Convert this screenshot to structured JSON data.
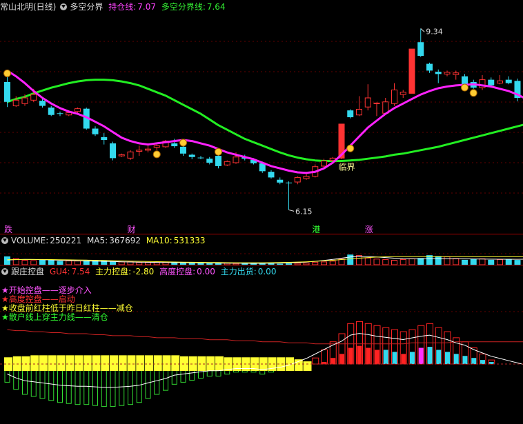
{
  "header": {
    "stock_title": "常山北明(日线)",
    "indicator_name": "多空分界",
    "hold_label": "持仓线:",
    "hold_value": "7.07",
    "boundary_label": "多空分界线:",
    "boundary_value": "7.64"
  },
  "annotations": {
    "high": "9.34",
    "low": "6.15",
    "cross": "临界"
  },
  "markers": [
    {
      "text": "跌",
      "color": "#ff55ff",
      "candle": 0
    },
    {
      "text": "财",
      "color": "#ff55ff",
      "candle": 14
    },
    {
      "text": "港",
      "color": "#33ff33",
      "candle": 35
    },
    {
      "text": "涨",
      "color": "#ff55ff",
      "candle": 41
    }
  ],
  "volume_header": {
    "label": "VOLUME:",
    "value": "250221",
    "ma5_label": "MA5:",
    "ma5_value": "367692",
    "ma10_label": "MA10:",
    "ma10_value": "531333"
  },
  "control_header": {
    "name": "跟庄控盘",
    "gu4_label": "GU4:",
    "gu4_value": "7.54",
    "main_label": "主力控盘:",
    "main_value": "-2.80",
    "high_label": "高度控盘:",
    "high_value": "0.00",
    "ship_label": "主力出货:",
    "ship_value": "0.00"
  },
  "legend": [
    {
      "text": "开始控盘——逐步介入",
      "color": "#ff55ff"
    },
    {
      "text": "高度控盘——启动",
      "color": "#ff3333"
    },
    {
      "text": "收盘前红柱低于昨日红柱——减仓",
      "color": "#ffff33"
    },
    {
      "text": "散户线上穿主力线——清仓",
      "color": "#33ff33"
    }
  ],
  "colors": {
    "up": "#ff3333",
    "down": "#33d9ee",
    "hold_line": "#ff22ff",
    "boundary_line": "#22ee22",
    "yellow": "#ffff33",
    "magenta": "#ff55ff",
    "green": "#33ff33"
  },
  "chart_data": {
    "type": "candlestick",
    "price_range": [
      5.9,
      9.6
    ],
    "high_label": 9.34,
    "low_label": 6.15,
    "candles": [
      [
        8.4,
        8.05,
        8.5,
        7.96
      ],
      [
        7.98,
        8.08,
        8.15,
        7.96
      ],
      [
        8.02,
        8.12,
        8.18,
        7.98
      ],
      [
        8.08,
        8.18,
        8.28,
        8.05
      ],
      [
        8.07,
        7.98,
        8.12,
        7.95
      ],
      [
        7.95,
        7.82,
        7.98,
        7.8
      ],
      [
        7.85,
        7.84,
        7.88,
        7.8
      ],
      [
        7.82,
        7.86,
        7.9,
        7.8
      ],
      [
        7.88,
        7.93,
        7.95,
        7.86
      ],
      [
        7.93,
        7.58,
        7.95,
        7.56
      ],
      [
        7.58,
        7.48,
        7.62,
        7.45
      ],
      [
        7.43,
        7.38,
        7.5,
        7.3
      ],
      [
        7.32,
        7.06,
        7.35,
        7.02
      ],
      [
        7.1,
        7.12,
        7.14,
        7.08
      ],
      [
        7.06,
        7.17,
        7.2,
        7.03
      ],
      [
        7.18,
        7.2,
        7.28,
        7.1
      ],
      [
        7.2,
        7.22,
        7.32,
        7.16
      ],
      [
        7.25,
        7.28,
        7.3,
        7.2
      ],
      [
        7.26,
        7.36,
        7.38,
        7.24
      ],
      [
        7.32,
        7.27,
        7.4,
        7.24
      ],
      [
        7.26,
        7.14,
        7.3,
        7.1
      ],
      [
        7.12,
        7.08,
        7.14,
        7.04
      ],
      [
        7.07,
        7.06,
        7.1,
        7.04
      ],
      [
        7.05,
        6.98,
        7.08,
        6.95
      ],
      [
        7.1,
        6.92,
        7.12,
        6.88
      ],
      [
        6.94,
        7.0,
        7.02,
        6.92
      ],
      [
        6.98,
        7.08,
        7.16,
        6.96
      ],
      [
        7.08,
        7.05,
        7.12,
        7.02
      ],
      [
        7.03,
        6.97,
        7.06,
        6.95
      ],
      [
        6.97,
        6.83,
        7.0,
        6.8
      ],
      [
        6.82,
        6.72,
        6.85,
        6.7
      ],
      [
        6.68,
        6.63,
        6.72,
        6.6
      ],
      [
        6.63,
        6.62,
        6.65,
        6.15
      ],
      [
        6.64,
        6.72,
        6.74,
        6.6
      ],
      [
        6.7,
        6.74,
        6.78,
        6.68
      ],
      [
        6.74,
        6.91,
        6.95,
        6.72
      ],
      [
        6.92,
        7.01,
        7.05,
        6.9
      ],
      [
        7.02,
        7.06,
        7.08,
        7.0
      ],
      [
        7.06,
        7.66,
        7.66,
        7.04
      ],
      [
        7.9,
        7.78,
        7.92,
        7.76
      ],
      [
        7.82,
        7.92,
        8.15,
        7.8
      ],
      [
        7.96,
        8.12,
        8.36,
        7.9
      ],
      [
        8.02,
        8.03,
        8.04,
        7.8
      ],
      [
        7.85,
        8.05,
        8.12,
        7.83
      ],
      [
        8.02,
        8.26,
        8.38,
        7.98
      ],
      [
        8.18,
        8.22,
        8.26,
        8.12
      ],
      [
        8.2,
        8.98,
        8.98,
        8.2
      ],
      [
        9.1,
        8.86,
        9.34,
        8.84
      ],
      [
        8.72,
        8.6,
        8.74,
        8.56
      ],
      [
        8.58,
        8.54,
        8.62,
        8.38
      ],
      [
        8.54,
        8.57,
        8.6,
        8.5
      ],
      [
        8.53,
        8.56,
        8.6,
        8.44
      ],
      [
        8.5,
        8.36,
        8.54,
        8.34
      ],
      [
        8.4,
        8.3,
        8.44,
        8.28
      ],
      [
        8.3,
        8.44,
        8.52,
        8.26
      ],
      [
        8.44,
        8.34,
        8.48,
        8.3
      ],
      [
        8.38,
        8.42,
        8.52,
        8.36
      ],
      [
        8.44,
        8.38,
        8.5,
        8.36
      ],
      [
        8.42,
        8.12,
        8.46,
        8.06
      ],
      [
        8.05,
        7.82,
        8.08,
        7.8
      ],
      [
        7.9,
        7.65,
        7.98,
        7.62
      ]
    ],
    "hold_line": [
      8.6,
      8.5,
      8.38,
      8.24,
      8.12,
      8.02,
      7.94,
      7.88,
      7.84,
      7.78,
      7.7,
      7.62,
      7.52,
      7.42,
      7.36,
      7.32,
      7.3,
      7.32,
      7.34,
      7.36,
      7.38,
      7.36,
      7.32,
      7.28,
      7.22,
      7.16,
      7.12,
      7.08,
      7.04,
      6.98,
      6.92,
      6.88,
      6.84,
      6.81,
      6.8,
      6.82,
      6.88,
      6.98,
      7.12,
      7.28,
      7.44,
      7.6,
      7.72,
      7.84,
      7.94,
      8.02,
      8.1,
      8.18,
      8.24,
      8.29,
      8.32,
      8.34,
      8.35,
      8.36,
      8.34,
      8.32,
      8.28,
      8.24,
      8.18,
      8.1,
      8.0
    ],
    "boundary_line": [
      8.05,
      8.1,
      8.14,
      8.2,
      8.25,
      8.3,
      8.34,
      8.38,
      8.41,
      8.43,
      8.44,
      8.44,
      8.43,
      8.41,
      8.38,
      8.34,
      8.28,
      8.22,
      8.16,
      8.08,
      8.0,
      7.92,
      7.84,
      7.74,
      7.64,
      7.56,
      7.48,
      7.4,
      7.34,
      7.28,
      7.22,
      7.16,
      7.11,
      7.07,
      7.04,
      7.02,
      7.01,
      7.01,
      7.01,
      7.02,
      7.03,
      7.05,
      7.07,
      7.09,
      7.12,
      7.14,
      7.17,
      7.2,
      7.23,
      7.26,
      7.3,
      7.34,
      7.38,
      7.42,
      7.46,
      7.5,
      7.54,
      7.58,
      7.62,
      7.66,
      7.7
    ],
    "volume": {
      "range": [
        0,
        1200000
      ],
      "bars": [
        560000,
        420000,
        300000,
        280000,
        330000,
        300000,
        250000,
        260000,
        250000,
        290000,
        300000,
        280000,
        230000,
        190000,
        200000,
        160000,
        150000,
        150000,
        160000,
        150000,
        140000,
        130000,
        110000,
        100000,
        120000,
        100000,
        80000,
        90000,
        90000,
        100000,
        90000,
        70000,
        90000,
        95000,
        110000,
        170000,
        190000,
        240000,
        380000,
        680000,
        620000,
        450000,
        380000,
        350000,
        300000,
        350000,
        400000,
        450000,
        640000,
        580000,
        540000,
        420000,
        330000,
        390000,
        400000,
        330000,
        350000,
        370000,
        320000,
        280000,
        250000
      ],
      "ma5": [
        320000,
        340000,
        355000,
        350000,
        338000,
        322000,
        300000,
        280000,
        265000,
        250000,
        240000,
        228000,
        216000,
        200000,
        186000,
        172000,
        164000,
        158000,
        152000,
        146000,
        140000,
        134000,
        126000,
        118000,
        112000,
        106000,
        100000,
        96000,
        94000,
        96000,
        102000,
        112000,
        124000,
        148000,
        180000,
        230000,
        290000,
        360000,
        440000,
        520000,
        560000,
        550000,
        520000,
        480000,
        440000,
        410000,
        395000,
        390000,
        395000,
        400000,
        405000,
        400000,
        395000,
        390000,
        380000,
        375000,
        370000,
        368000,
        366000,
        367000,
        367692
      ],
      "ma10": [
        340000,
        345000,
        350000,
        352000,
        350000,
        345000,
        338000,
        330000,
        320000,
        310000,
        298000,
        286000,
        272000,
        258000,
        244000,
        230000,
        218000,
        206000,
        196000,
        186000,
        176000,
        168000,
        160000,
        152000,
        146000,
        140000,
        136000,
        134000,
        134000,
        136000,
        140000,
        148000,
        160000,
        178000,
        200000,
        228000,
        262000,
        300000,
        344000,
        392000,
        440000,
        480000,
        510000,
        530000,
        540000,
        545000,
        545000,
        542000,
        540000,
        538000,
        536000,
        535000,
        534000,
        533000,
        532000,
        531500,
        531333,
        531333,
        531333,
        531333,
        531333
      ]
    },
    "control": {
      "range": [
        -60,
        60
      ],
      "values": [
        -18,
        -25,
        -30,
        -32,
        -34,
        -36,
        -38,
        -39,
        -40,
        -40,
        -41,
        -42,
        -42,
        -41,
        -40,
        -38,
        -34,
        -30,
        -26,
        -20,
        -18,
        -16,
        -14,
        -12,
        -12,
        -10,
        -8,
        -8,
        -8,
        -10,
        -8,
        -6,
        -2,
        4,
        10,
        18,
        26,
        34,
        41,
        52,
        55,
        53,
        50,
        48,
        46,
        44,
        47,
        50,
        52,
        48,
        44,
        38,
        34,
        26,
        20,
        14,
        10,
        6,
        2,
        -2,
        -8
      ],
      "yellow": [
        8,
        9,
        9,
        10,
        10,
        10,
        10,
        10,
        10,
        10,
        10,
        10,
        10,
        10,
        10,
        10,
        10,
        10,
        10,
        10,
        9,
        9,
        9,
        9,
        9,
        8,
        8,
        8,
        8,
        8,
        8,
        8,
        8,
        6,
        4,
        0,
        0,
        0,
        0,
        0,
        0,
        0,
        0,
        0,
        0,
        0,
        0,
        0,
        0,
        0,
        0,
        0,
        0,
        0,
        0,
        0,
        0,
        0,
        0,
        3,
        5
      ],
      "hollow": [
        0,
        0,
        0,
        0,
        0,
        0,
        0,
        0,
        0,
        0,
        0,
        0,
        0,
        0,
        0,
        0,
        0,
        0,
        0,
        0,
        0,
        0,
        0,
        0,
        0,
        0,
        0,
        0,
        0,
        0,
        0,
        0,
        0,
        0,
        0,
        6,
        14,
        22,
        30,
        40,
        42,
        40,
        38,
        36,
        34,
        32,
        34,
        38,
        40,
        36,
        32,
        26,
        22,
        16,
        10,
        4,
        0,
        0,
        0,
        0,
        0
      ],
      "filled": [
        0,
        0,
        0,
        0,
        0,
        0,
        0,
        0,
        0,
        0,
        0,
        0,
        0,
        0,
        0,
        0,
        0,
        0,
        0,
        0,
        0,
        0,
        0,
        0,
        0,
        0,
        0,
        0,
        0,
        0,
        0,
        0,
        0,
        0,
        0,
        0,
        2,
        6,
        10,
        16,
        18,
        16,
        14,
        14,
        12,
        10,
        12,
        16,
        17,
        14,
        12,
        10,
        8,
        6,
        4,
        2,
        0,
        0,
        0,
        0,
        0
      ],
      "filled_colors": [
        "r",
        "r",
        "r",
        "r",
        "r",
        "r",
        "r",
        "r",
        "r",
        "r",
        "r",
        "r",
        "r",
        "r",
        "r",
        "r",
        "r",
        "r",
        "r",
        "r",
        "r",
        "r",
        "r",
        "r",
        "r",
        "r",
        "r",
        "r",
        "r",
        "r",
        "r",
        "r",
        "r",
        "r",
        "r",
        "r",
        "r",
        "r",
        "r",
        "r",
        "r",
        "r",
        "r",
        "c",
        "c",
        "r",
        "c",
        "m",
        "c",
        "c",
        "c",
        "c",
        "c",
        "c",
        "c",
        "c",
        "c",
        "c",
        "c",
        "c",
        "c"
      ],
      "trend": [
        34,
        33,
        33,
        32,
        32,
        31,
        31,
        30,
        30,
        30,
        29,
        29,
        28,
        28,
        28,
        27,
        27,
        26,
        26,
        26,
        25,
        25,
        25,
        24,
        24,
        24,
        23,
        23,
        23,
        22,
        22,
        22,
        21,
        21,
        21,
        20,
        20,
        20,
        20,
        20,
        20,
        20,
        20,
        20,
        20,
        20,
        21,
        21,
        21,
        21,
        21,
        22,
        22,
        22,
        22,
        22,
        22,
        22,
        22,
        22,
        22
      ]
    }
  }
}
